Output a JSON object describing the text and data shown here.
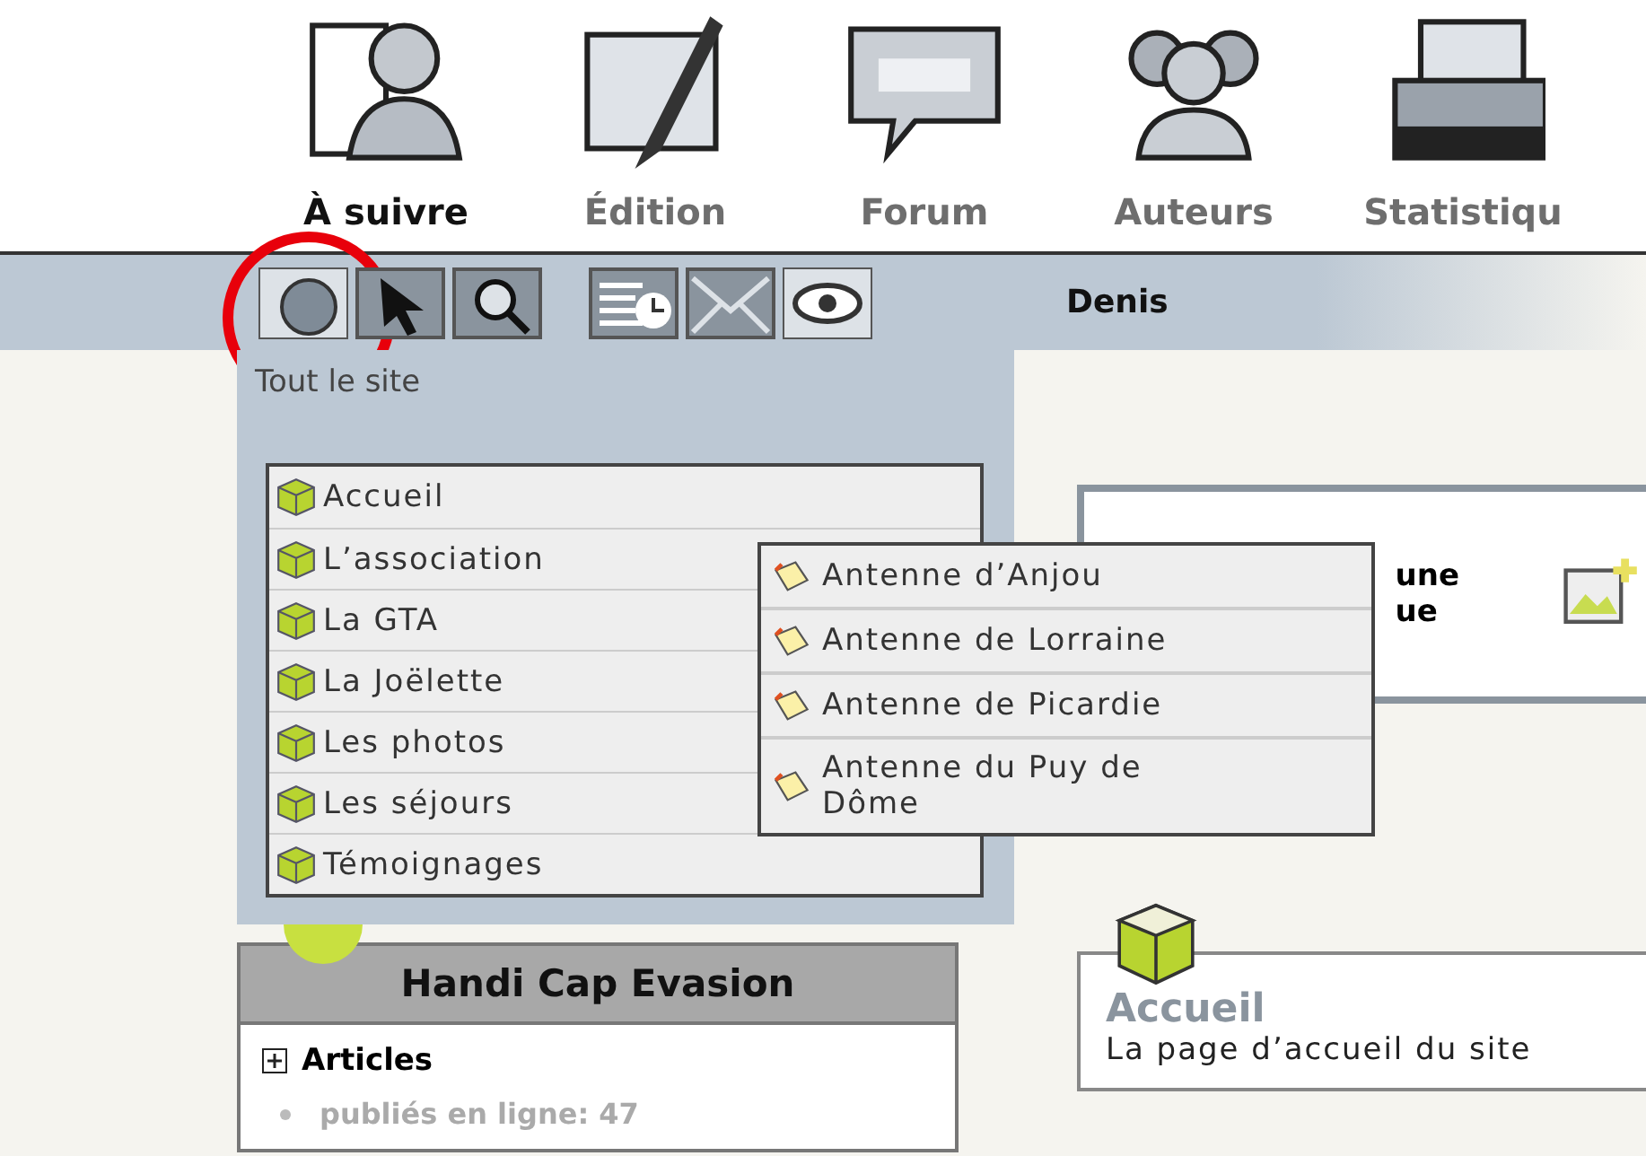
{
  "nav": [
    {
      "label": "À suivre",
      "kind": "person",
      "selected": true
    },
    {
      "label": "Édition",
      "kind": "edit",
      "selected": false
    },
    {
      "label": "Forum",
      "kind": "forum",
      "selected": false
    },
    {
      "label": "Auteurs",
      "kind": "people",
      "selected": false
    },
    {
      "label": "Statistiqu",
      "kind": "stats",
      "selected": false
    }
  ],
  "toolbar": {
    "groups": [
      [
        {
          "kind": "globe",
          "highlighted": true
        },
        {
          "kind": "cursor",
          "highlighted": false
        },
        {
          "kind": "search",
          "highlighted": false
        }
      ],
      [
        {
          "kind": "clock-list",
          "highlighted": false
        },
        {
          "kind": "mail",
          "highlighted": false
        },
        {
          "kind": "eye",
          "highlighted": false
        }
      ]
    ],
    "user": "Denis"
  },
  "scope_label": "Tout le site",
  "menu": [
    {
      "label": "Accueil"
    },
    {
      "label": "L’association",
      "children": [
        {
          "label": "Antenne d’Anjou"
        },
        {
          "label": "Antenne de Lorraine"
        },
        {
          "label": "Antenne de Picardie"
        },
        {
          "label": "Antenne du Puy de Dôme"
        }
      ]
    },
    {
      "label": "La GTA"
    },
    {
      "label": "La Joëlette"
    },
    {
      "label": "Les photos"
    },
    {
      "label": "Les séjours"
    },
    {
      "label": "Témoignages"
    }
  ],
  "info_box": {
    "lines": [
      "une",
      "ue"
    ]
  },
  "site_box": {
    "title": "Handi Cap Evasion",
    "section": "Articles",
    "stat": "publiés en ligne: 47"
  },
  "home_card": {
    "title": "Accueil",
    "description": "La page d’accueil du site"
  }
}
